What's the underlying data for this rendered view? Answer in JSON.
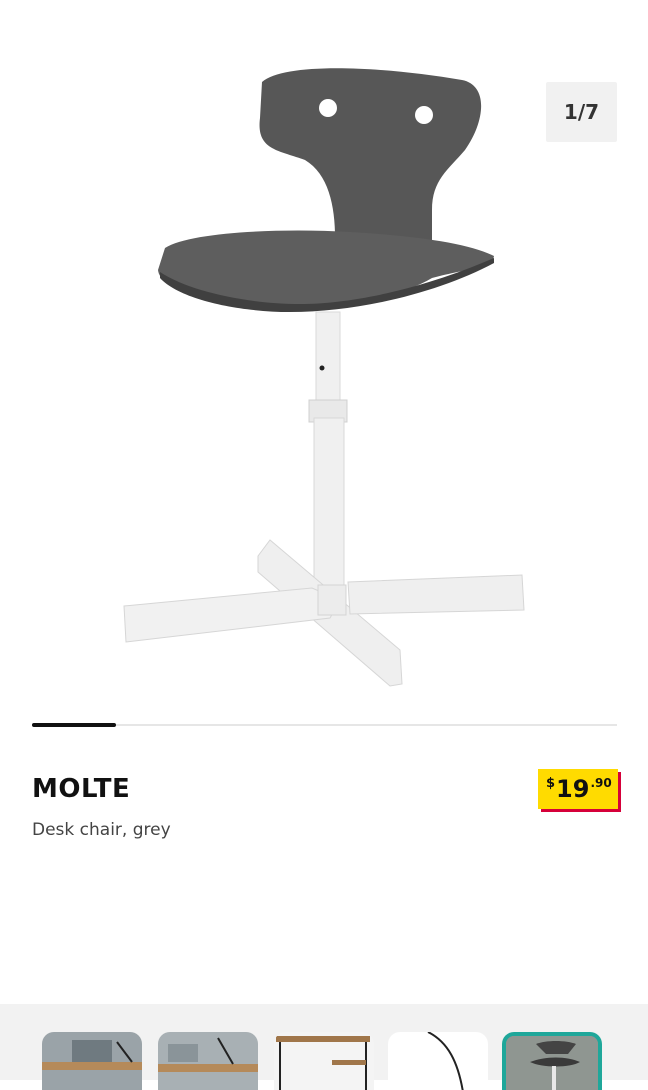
{
  "gallery": {
    "counter": "1/7",
    "progress": 0.143,
    "main_image_alt": "MOLTE desk chair, grey",
    "thumbnails": [
      {
        "alt": "Desk setup with chair",
        "active": false
      },
      {
        "alt": "Desk setup with lamp",
        "active": false
      },
      {
        "alt": "Desk frame",
        "active": false
      },
      {
        "alt": "Cable detail",
        "active": false
      },
      {
        "alt": "MOLTE desk chair",
        "active": true
      }
    ]
  },
  "product": {
    "name": "MOLTE",
    "description": "Desk chair, grey",
    "price": {
      "currency": "$",
      "integer": "19",
      "decimal": ".90"
    }
  },
  "colors": {
    "price_tag_bg": "#ffdb00",
    "price_tag_shadow": "#d6003a",
    "seat": "#5a5a5a",
    "frame": "#f0f0f0",
    "thumb_active_border": "#1fa79a"
  }
}
